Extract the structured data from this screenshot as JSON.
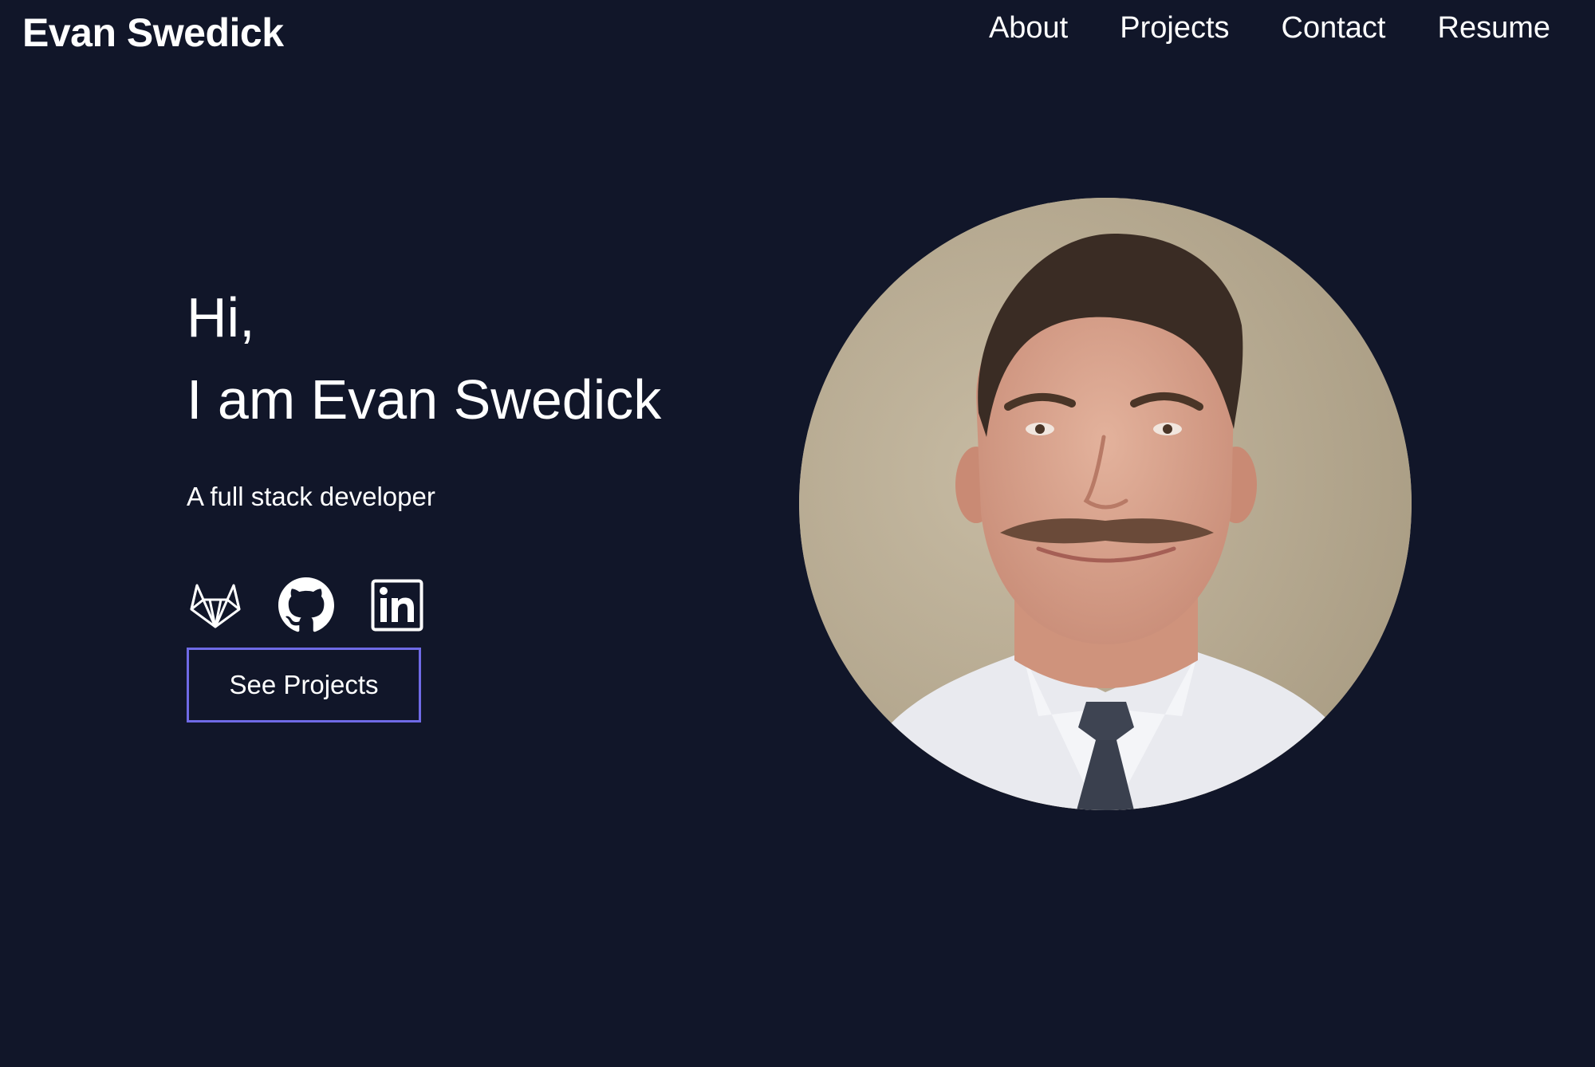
{
  "header": {
    "brand": "Evan Swedick",
    "nav": [
      {
        "label": "About"
      },
      {
        "label": "Projects"
      },
      {
        "label": "Contact"
      },
      {
        "label": "Resume"
      }
    ]
  },
  "hero": {
    "greeting": "Hi,",
    "intro": "I am Evan Swedick",
    "tagline": "A full stack developer",
    "socials": [
      {
        "icon": "gitlab-icon"
      },
      {
        "icon": "github-icon"
      },
      {
        "icon": "linkedin-icon"
      }
    ],
    "cta_label": "See Projects"
  },
  "portrait": {
    "alt": "Portrait photo"
  },
  "colors": {
    "background": "#111629",
    "text": "#ffffff",
    "accent_border": "#6f6ae6"
  }
}
